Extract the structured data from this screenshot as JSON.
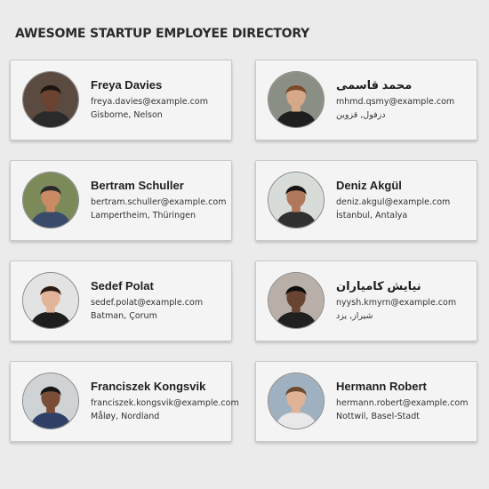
{
  "page": {
    "title": "AWESOME STARTUP EMPLOYEE DIRECTORY"
  },
  "employees": [
    {
      "name": "Freya Davies",
      "email": "freya.davies@example.com",
      "location": "Gisborne, Nelson",
      "avatar": {
        "icon": "avatar-photo-icon",
        "bg": "#5a4a40",
        "skin": "#6b4330",
        "hair": "#1b1410",
        "shirt": "#2a2a2a"
      }
    },
    {
      "name": "محمد قاسمی",
      "email": "mhmd.qsmy@example.com",
      "location": "دزفول, قزوین",
      "avatar": {
        "icon": "avatar-photo-icon",
        "bg": "#8a8f86",
        "skin": "#d7a888",
        "hair": "#7a4a2a",
        "shirt": "#1e1e1e"
      }
    },
    {
      "name": "Bertram Schuller",
      "email": "bertram.schuller@example.com",
      "location": "Lampertheim, Thüringen",
      "avatar": {
        "icon": "avatar-photo-icon",
        "bg": "#7c8a5a",
        "skin": "#c98a64",
        "hair": "#2a2a2a",
        "shirt": "#3a4a6a"
      }
    },
    {
      "name": "Deniz Akgül",
      "email": "deniz.akgul@example.com",
      "location": "İstanbul, Antalya",
      "avatar": {
        "icon": "avatar-photo-icon",
        "bg": "#d8dcd8",
        "skin": "#b0785a",
        "hair": "#151515",
        "shirt": "#303030"
      }
    },
    {
      "name": "Sedef Polat",
      "email": "sedef.polat@example.com",
      "location": "Batman, Çorum",
      "avatar": {
        "icon": "avatar-photo-icon",
        "bg": "#e3e3e3",
        "skin": "#e2b59a",
        "hair": "#2a1a12",
        "shirt": "#1e1e1e"
      }
    },
    {
      "name": "نیایش کامیاران",
      "email": "nyysh.kmyrn@example.com",
      "location": "شیراز, یزد",
      "avatar": {
        "icon": "avatar-photo-icon",
        "bg": "#b8b0a8",
        "skin": "#6a4433",
        "hair": "#0e0e0e",
        "shirt": "#202020"
      }
    },
    {
      "name": "Franciszek Kongsvik",
      "email": "franciszek.kongsvik@example.com",
      "location": "Måløy, Nordland",
      "avatar": {
        "icon": "avatar-photo-icon",
        "bg": "#d0d3d6",
        "skin": "#7a4e36",
        "hair": "#161616",
        "shirt": "#2f3f66"
      }
    },
    {
      "name": "Hermann Robert",
      "email": "hermann.robert@example.com",
      "location": "Nottwil, Basel-Stadt",
      "avatar": {
        "icon": "avatar-photo-icon",
        "bg": "#9fb0c0",
        "skin": "#e0b396",
        "hair": "#6a4a30",
        "shirt": "#e8e8e8"
      }
    }
  ]
}
